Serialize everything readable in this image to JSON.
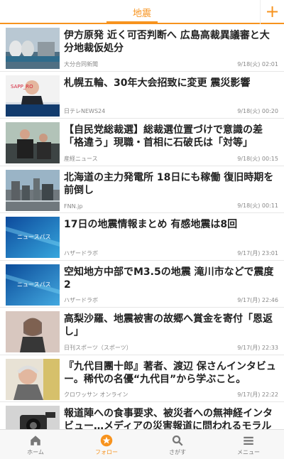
{
  "header": {
    "title": "地震",
    "add_icon": "plus-icon"
  },
  "articles": [
    {
      "title": "伊方原発 近く可否判断へ 広島高裁異議審と大分地裁仮処分",
      "source": "大分合同新聞",
      "time": "9/18(火) 02:01",
      "thumb": "power-plant"
    },
    {
      "title": "札幌五輪、30年大会招致に変更 震災影響",
      "source": "日テレNEWS24",
      "time": "9/18(火) 00:20",
      "thumb": "press-conference",
      "thumb_text": "SAPP_RO"
    },
    {
      "title": "【自民党総裁選】総裁選位置づけで意識の差 「格違う」現職・首相に石破氏は「対等」",
      "source": "産経ニュース",
      "time": "9/18(火) 00:15",
      "thumb": "politician-crowd"
    },
    {
      "title": "北海道の主力発電所 18日にも稼働 復旧時期を前倒し",
      "source": "FNN.jp",
      "time": "9/18(火) 00:11",
      "thumb": "factory"
    },
    {
      "title": "17日の地震情報まとめ 有感地震は8回",
      "source": "ハザードラボ",
      "time": "9/17(月) 23:01",
      "thumb": "news-pass",
      "thumb_text": "ニュースパス"
    },
    {
      "title": "空知地方中部でM3.5の地震 滝川市などで震度2",
      "source": "ハザードラボ",
      "time": "9/17(月) 22:46",
      "thumb": "news-pass",
      "thumb_text": "ニュースパス"
    },
    {
      "title": "高梨沙羅、地震被害の故郷へ賞金を寄付「恩返し」",
      "source": "日刊スポーツ（スポーツ）",
      "time": "9/17(月) 22:33",
      "thumb": "athlete"
    },
    {
      "title": "『九代目團十郎』著者、渡辺 保さんインタビュー。稀代の名優“九代目”から学ぶこと。",
      "source": "クロワッサン オンライン",
      "time": "9/17(月) 22:22",
      "thumb": "elder-portrait"
    },
    {
      "title": "報道陣への食事要求、被災者への無神経インタビュー…メディアの災害報道に問われるモラル",
      "source": "",
      "time": "",
      "thumb": "camera"
    }
  ],
  "tabbar": [
    {
      "label": "ホーム",
      "icon": "home-icon",
      "active": false
    },
    {
      "label": "フォロー",
      "icon": "star-icon",
      "active": true
    },
    {
      "label": "さがす",
      "icon": "search-icon",
      "active": false
    },
    {
      "label": "メニュー",
      "icon": "menu-icon",
      "active": false
    }
  ],
  "colors": {
    "accent": "#f7931e",
    "text": "#222222",
    "meta": "#888888"
  }
}
